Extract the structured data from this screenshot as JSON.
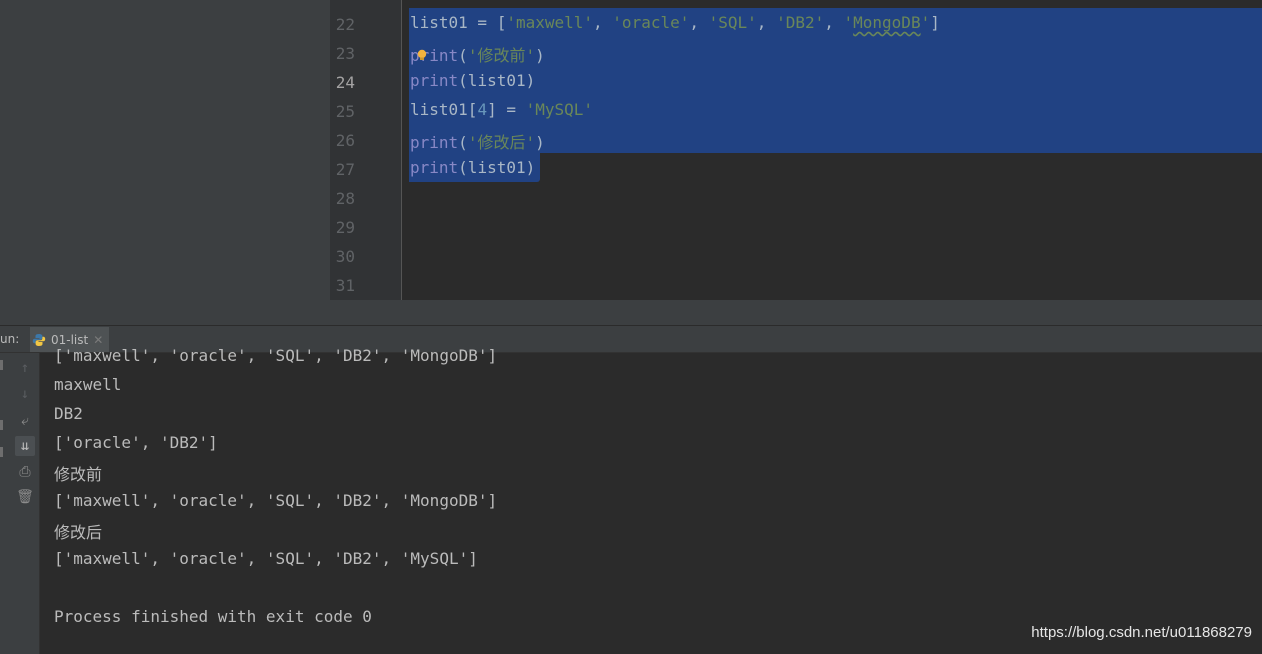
{
  "editor": {
    "line_numbers": [
      "22",
      "23",
      "24",
      "25",
      "26",
      "27",
      "28",
      "29",
      "30",
      "31"
    ],
    "current_line": "24",
    "code_lines": {
      "l22": {
        "a": "list01 = [",
        "s1": "'maxwell'",
        "c1": ", ",
        "s2": "'oracle'",
        "c2": ", ",
        "s3": "'SQL'",
        "c3": ", ",
        "s4": "'DB2'",
        "c4": ", ",
        "s5a": "'",
        "s5b": "MongoDB",
        "s5c": "'",
        "b": "]"
      },
      "l23": {
        "k": "print",
        "a": "(",
        "s": "'修改前'",
        "b": ")"
      },
      "l24": {
        "k": "print",
        "a": "(list01)"
      },
      "l25": {
        "a": "list01[",
        "n": "4",
        "b": "] = ",
        "s": "'MySQL'"
      },
      "l26": {
        "k": "print",
        "a": "(",
        "s": "'修改后'",
        "b": ")"
      },
      "l27": {
        "k": "print",
        "a": "(list01)"
      }
    },
    "colors": {
      "selection": "#214283",
      "keyword": "#8888c6",
      "string": "#6a8759",
      "number": "#6897bb",
      "text": "#a9b7c6"
    }
  },
  "run_window": {
    "label": "un:",
    "tab_name": "01-list",
    "toolbar": [
      {
        "icon": "arrow-up-icon"
      },
      {
        "icon": "arrow-down-icon"
      },
      {
        "icon": "soft-wrap-icon"
      },
      {
        "icon": "scroll-to-end-icon"
      },
      {
        "icon": "print-icon"
      },
      {
        "icon": "trash-icon"
      }
    ],
    "output": [
      "['maxwell', 'oracle', 'SQL', 'DB2', 'MongoDB']",
      "maxwell",
      "DB2",
      "['oracle', 'DB2']",
      "修改前",
      "['maxwell', 'oracle', 'SQL', 'DB2', 'MongoDB']",
      "修改后",
      "['maxwell', 'oracle', 'SQL', 'DB2', 'MySQL']",
      "",
      "Process finished with exit code 0"
    ]
  },
  "watermark": "https://blog.csdn.net/u011868279"
}
